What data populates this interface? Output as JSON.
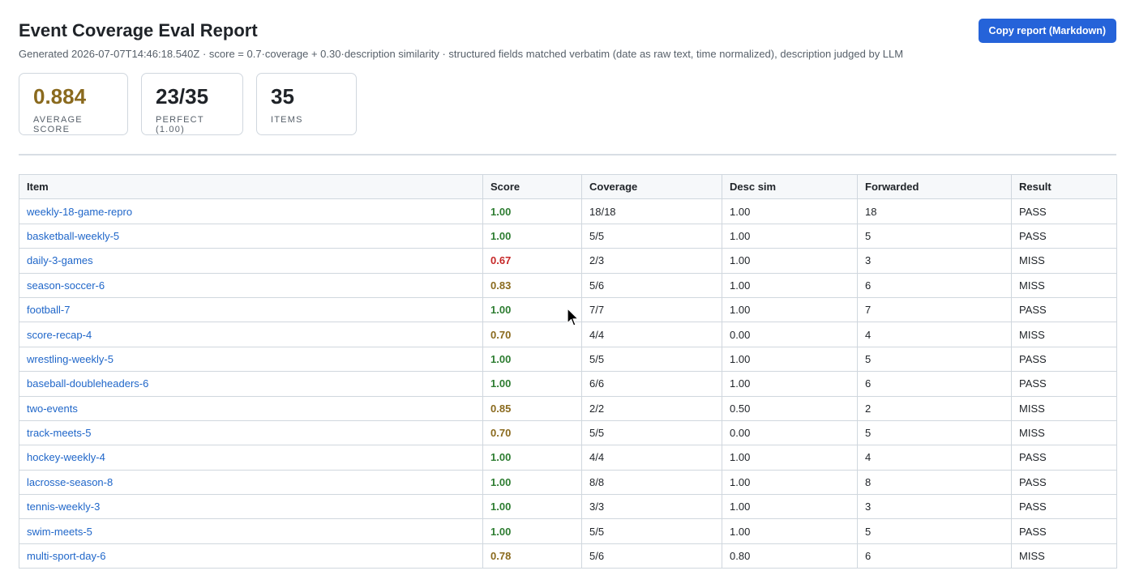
{
  "header": {
    "title": "Event Coverage Eval Report",
    "subtitle": "Generated 2026-07-07T14:46:18.540Z · score = 0.7·coverage + 0.30·description similarity · structured fields matched verbatim (date as raw text, time normalized), description judged by LLM",
    "copy_button_label": "Copy report (Markdown)"
  },
  "stats": [
    {
      "value": "0.884",
      "label": "Average score"
    },
    {
      "value": "23/35",
      "label": "Perfect (1.00)"
    },
    {
      "value": "35",
      "label": "Items"
    }
  ],
  "table": {
    "columns": [
      "Item",
      "Score",
      "Coverage",
      "Desc sim",
      "Forwarded",
      "Result"
    ],
    "rows": [
      {
        "item": "weekly-18-game-repro",
        "score": "1.00",
        "coverage": "18/18",
        "desc_sim": "1.00",
        "forwarded": "18",
        "result": "PASS"
      },
      {
        "item": "basketball-weekly-5",
        "score": "1.00",
        "coverage": "5/5",
        "desc_sim": "1.00",
        "forwarded": "5",
        "result": "PASS"
      },
      {
        "item": "daily-3-games",
        "score": "0.67",
        "coverage": "2/3",
        "desc_sim": "1.00",
        "forwarded": "3",
        "result": "MISS"
      },
      {
        "item": "season-soccer-6",
        "score": "0.83",
        "coverage": "5/6",
        "desc_sim": "1.00",
        "forwarded": "6",
        "result": "MISS"
      },
      {
        "item": "football-7",
        "score": "1.00",
        "coverage": "7/7",
        "desc_sim": "1.00",
        "forwarded": "7",
        "result": "PASS"
      },
      {
        "item": "score-recap-4",
        "score": "0.70",
        "coverage": "4/4",
        "desc_sim": "0.00",
        "forwarded": "4",
        "result": "MISS"
      },
      {
        "item": "wrestling-weekly-5",
        "score": "1.00",
        "coverage": "5/5",
        "desc_sim": "1.00",
        "forwarded": "5",
        "result": "PASS"
      },
      {
        "item": "baseball-doubleheaders-6",
        "score": "1.00",
        "coverage": "6/6",
        "desc_sim": "1.00",
        "forwarded": "6",
        "result": "PASS"
      },
      {
        "item": "two-events",
        "score": "0.85",
        "coverage": "2/2",
        "desc_sim": "0.50",
        "forwarded": "2",
        "result": "MISS"
      },
      {
        "item": "track-meets-5",
        "score": "0.70",
        "coverage": "5/5",
        "desc_sim": "0.00",
        "forwarded": "5",
        "result": "MISS"
      },
      {
        "item": "hockey-weekly-4",
        "score": "1.00",
        "coverage": "4/4",
        "desc_sim": "1.00",
        "forwarded": "4",
        "result": "PASS"
      },
      {
        "item": "lacrosse-season-8",
        "score": "1.00",
        "coverage": "8/8",
        "desc_sim": "1.00",
        "forwarded": "8",
        "result": "PASS"
      },
      {
        "item": "tennis-weekly-3",
        "score": "1.00",
        "coverage": "3/3",
        "desc_sim": "1.00",
        "forwarded": "3",
        "result": "PASS"
      },
      {
        "item": "swim-meets-5",
        "score": "1.00",
        "coverage": "5/5",
        "desc_sim": "1.00",
        "forwarded": "5",
        "result": "PASS"
      },
      {
        "item": "multi-sport-day-6",
        "score": "0.78",
        "coverage": "5/6",
        "desc_sim": "0.80",
        "forwarded": "6",
        "result": "MISS"
      }
    ]
  },
  "colors": {
    "score_high": "#2e7d32",
    "score_mid": "#8a6a1e",
    "score_low": "#c62828",
    "link": "#1f66c9",
    "button": "#2563d9"
  }
}
